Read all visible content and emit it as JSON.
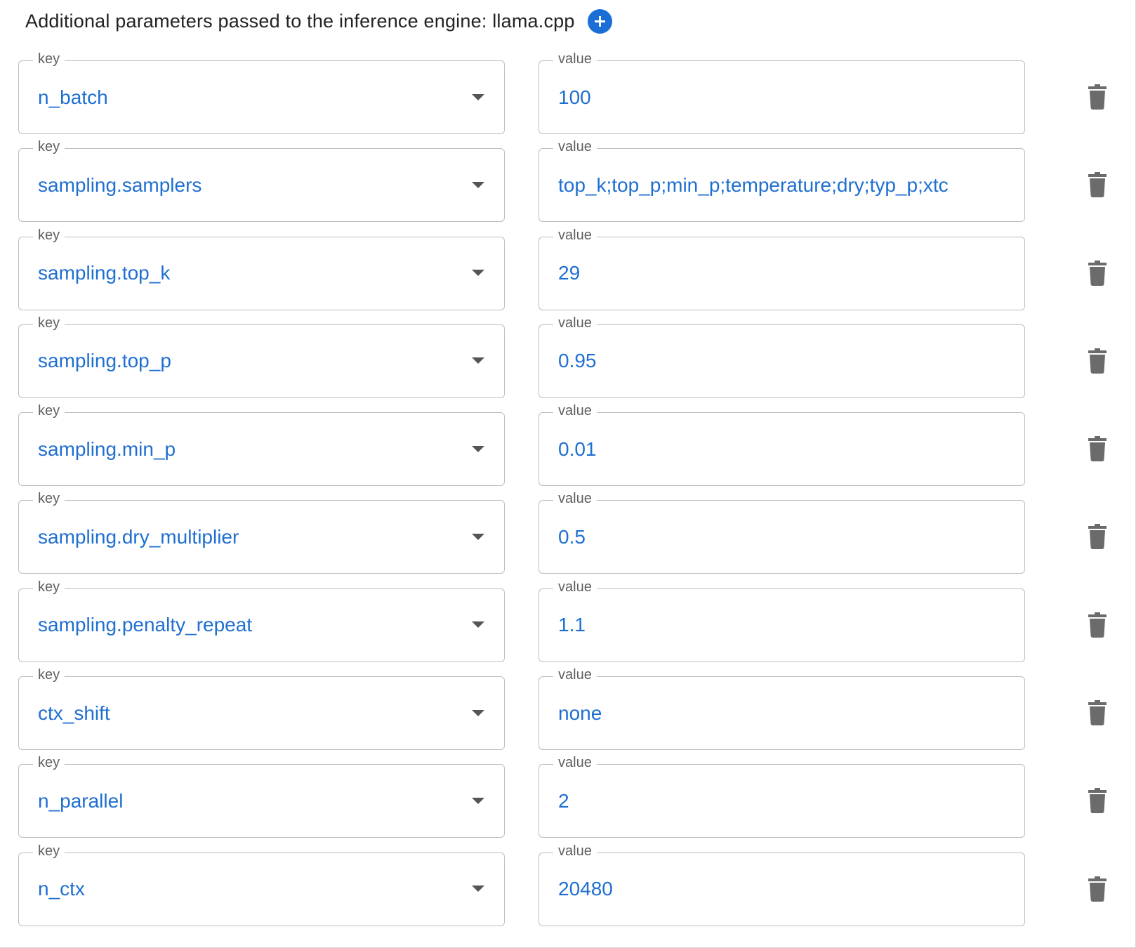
{
  "header": {
    "title": "Additional parameters passed to the inference engine: llama.cpp",
    "add_icon": "plus-circle-icon"
  },
  "labels": {
    "key": "key",
    "value": "value"
  },
  "colors": {
    "accent": "#1a6fd6",
    "field_text": "#1f6fd1",
    "icon": "#6b6b6b"
  },
  "params": [
    {
      "key": "n_batch",
      "value": "100"
    },
    {
      "key": "sampling.samplers",
      "value": "top_k;top_p;min_p;temperature;dry;typ_p;xtc"
    },
    {
      "key": "sampling.top_k",
      "value": "29"
    },
    {
      "key": "sampling.top_p",
      "value": "0.95"
    },
    {
      "key": "sampling.min_p",
      "value": "0.01"
    },
    {
      "key": "sampling.dry_multiplier",
      "value": "0.5"
    },
    {
      "key": "sampling.penalty_repeat",
      "value": "1.1"
    },
    {
      "key": "ctx_shift",
      "value": "none"
    },
    {
      "key": "n_parallel",
      "value": "2"
    },
    {
      "key": "n_ctx",
      "value": "20480"
    }
  ]
}
